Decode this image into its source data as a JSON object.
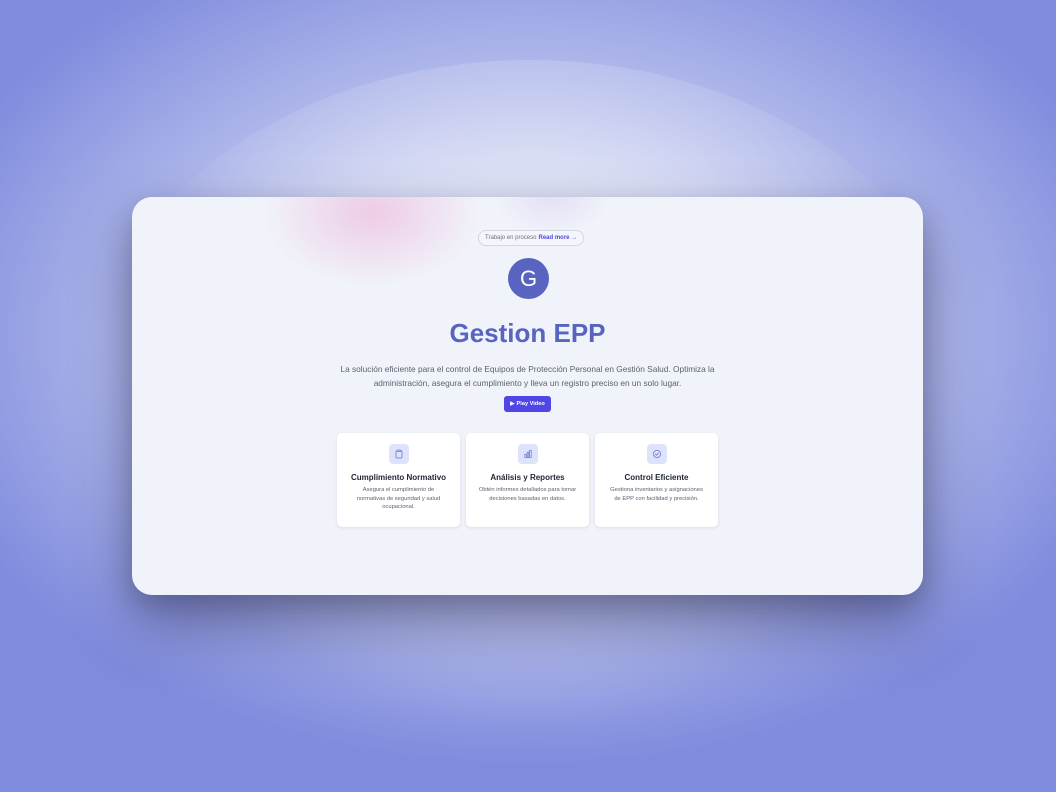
{
  "banner": {
    "text": "Trabajo en proceso",
    "link_label": "Read more",
    "link_arrow": "→"
  },
  "logo": {
    "letter": "G"
  },
  "hero": {
    "title": "Gestion EPP",
    "description": "La solución eficiente para el control de Equipos de Protección Personal en Gestión Salud. Optimiza la administración, asegura el cumplimiento y lleva un registro preciso en un solo lugar."
  },
  "play_button": {
    "icon": "▶",
    "label": "Play Video"
  },
  "features": [
    {
      "icon": "clipboard-icon",
      "title": "Cumplimiento Normativo",
      "description": "Asegura el cumplimiento de normativas de seguridad y salud ocupacional."
    },
    {
      "icon": "bar-chart-icon",
      "title": "Análisis y Reportes",
      "description": "Obtén informes detallados para tomar decisiones basadas en datos."
    },
    {
      "icon": "check-circle-icon",
      "title": "Control Eficiente",
      "description": "Gestiona inventarios y asignaciones de EPP con facilidad y precisión."
    }
  ],
  "colors": {
    "brand": "#5864c0",
    "accent": "#4f46e5",
    "icon_bg": "#dde3fb"
  }
}
